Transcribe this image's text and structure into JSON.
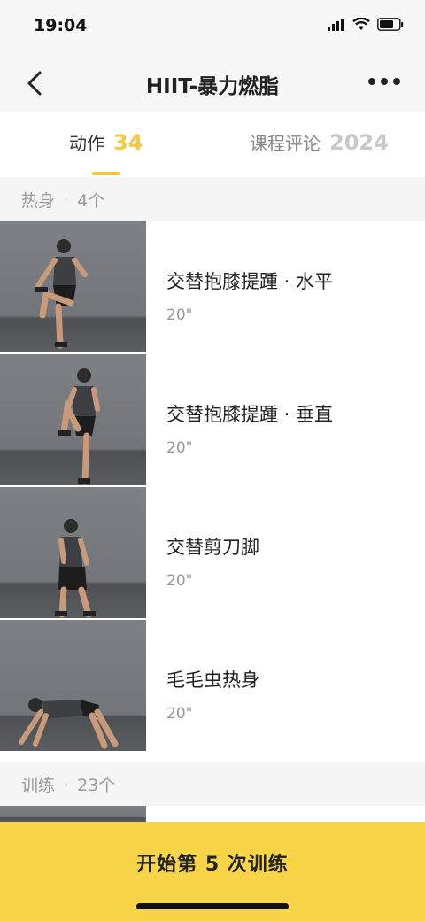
{
  "status_bar": {
    "time": "19:04"
  },
  "nav": {
    "title": "HIIT-暴力燃脂"
  },
  "tabs": [
    {
      "label": "动作",
      "count": "34"
    },
    {
      "label": "课程评论",
      "count": "2024"
    }
  ],
  "sections": [
    {
      "title": "热身",
      "count": "4个",
      "items": [
        {
          "name": "交替抱膝提踵 · 水平",
          "duration": "20\""
        },
        {
          "name": "交替抱膝提踵 · 垂直",
          "duration": "20\""
        },
        {
          "name": "交替剪刀脚",
          "duration": "20\""
        },
        {
          "name": "毛毛虫热身",
          "duration": "20\""
        }
      ]
    },
    {
      "title": "训练",
      "count": "23个"
    }
  ],
  "start_button": {
    "label": "开始第 5 次训练"
  },
  "colors": {
    "accent": "#f5c842",
    "start_bg": "#f7d448"
  }
}
